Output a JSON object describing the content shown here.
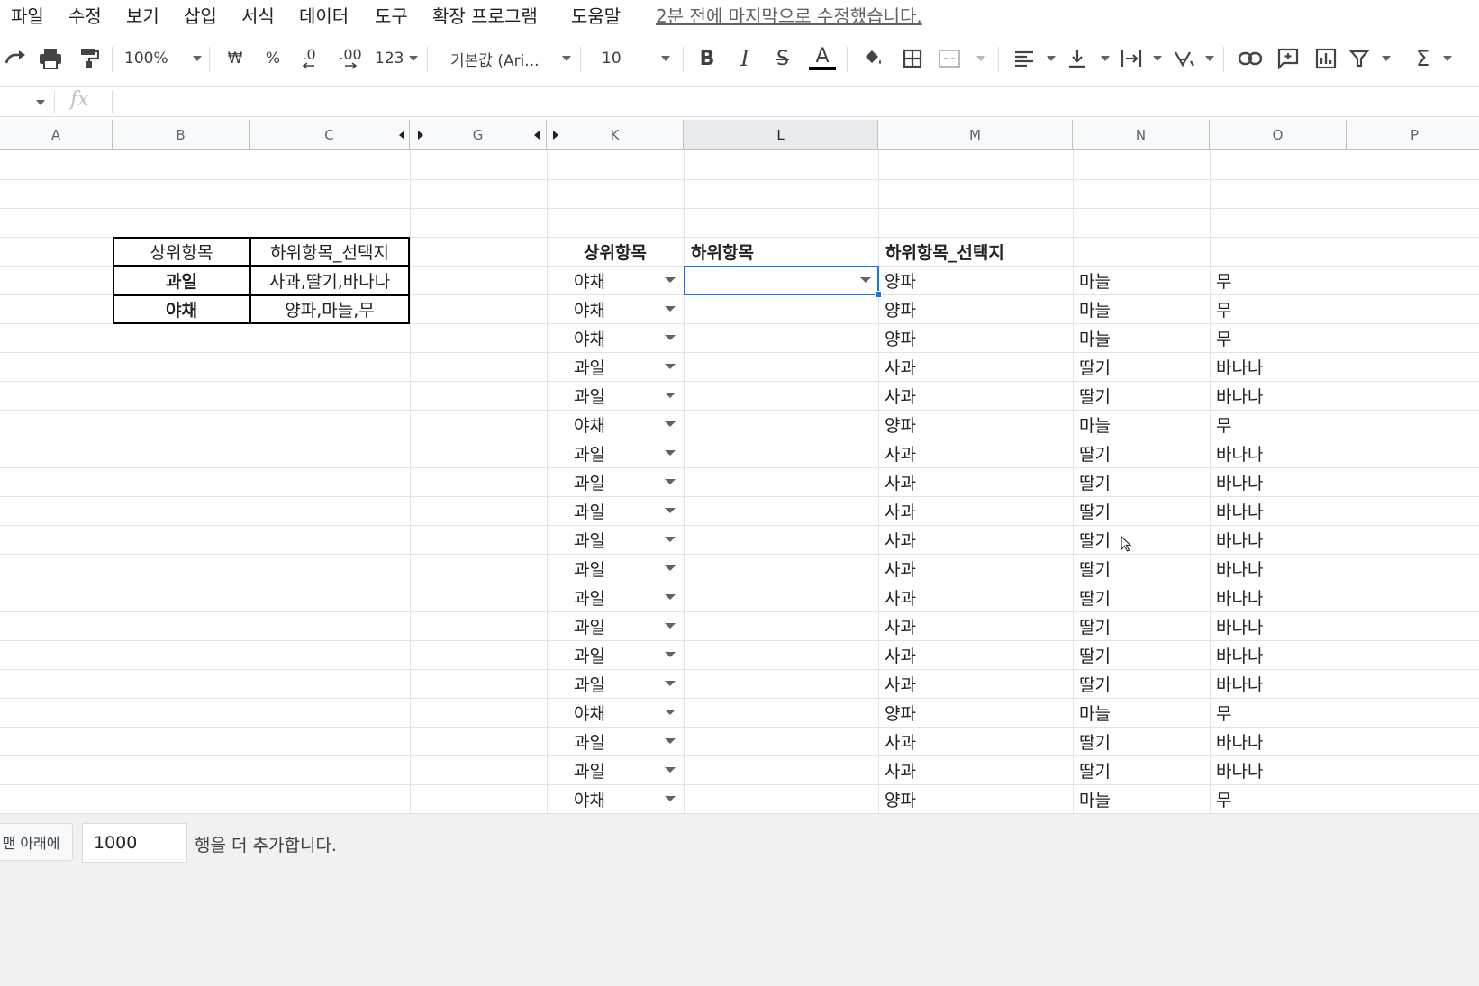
{
  "menu": {
    "items": [
      "파일",
      "수정",
      "보기",
      "삽입",
      "서식",
      "데이터",
      "도구",
      "확장 프로그램",
      "도움말"
    ],
    "last_edit": "2분 전에 마지막으로 수정했습니다."
  },
  "toolbar": {
    "zoom": "100%",
    "currency": "₩",
    "percent": "%",
    "decimal_decrease": ".0",
    "decimal_increase": ".00",
    "number_format": "123",
    "font": "기본값 (Ari...",
    "font_size": "10",
    "bold": "B",
    "italic": "I",
    "strikethrough": "S",
    "text_color": "A",
    "sum": "Σ"
  },
  "formula_bar": {
    "fx": "fx",
    "value": ""
  },
  "columns": [
    "A",
    "B",
    "C",
    "G",
    "K",
    "L",
    "M",
    "N",
    "O",
    "P"
  ],
  "selected_column": "L",
  "lookup_table": {
    "header": [
      "상위항목",
      "하위항목_선택지"
    ],
    "rows": [
      {
        "category": "과일",
        "options": "사과,딸기,바나나"
      },
      {
        "category": "야채",
        "options": "양파,마늘,무"
      }
    ]
  },
  "data_headers": {
    "k": "상위항목",
    "l": "하위항목",
    "m": "하위항목_선택지"
  },
  "data_rows": [
    {
      "k": "야채",
      "l": "",
      "m": "양파",
      "n": "마늘",
      "o": "무"
    },
    {
      "k": "야채",
      "l": "",
      "m": "양파",
      "n": "마늘",
      "o": "무"
    },
    {
      "k": "야채",
      "l": "",
      "m": "양파",
      "n": "마늘",
      "o": "무"
    },
    {
      "k": "과일",
      "l": "",
      "m": "사과",
      "n": "딸기",
      "o": "바나나"
    },
    {
      "k": "과일",
      "l": "",
      "m": "사과",
      "n": "딸기",
      "o": "바나나"
    },
    {
      "k": "야채",
      "l": "",
      "m": "양파",
      "n": "마늘",
      "o": "무"
    },
    {
      "k": "과일",
      "l": "",
      "m": "사과",
      "n": "딸기",
      "o": "바나나"
    },
    {
      "k": "과일",
      "l": "",
      "m": "사과",
      "n": "딸기",
      "o": "바나나"
    },
    {
      "k": "과일",
      "l": "",
      "m": "사과",
      "n": "딸기",
      "o": "바나나"
    },
    {
      "k": "과일",
      "l": "",
      "m": "사과",
      "n": "딸기",
      "o": "바나나"
    },
    {
      "k": "과일",
      "l": "",
      "m": "사과",
      "n": "딸기",
      "o": "바나나"
    },
    {
      "k": "과일",
      "l": "",
      "m": "사과",
      "n": "딸기",
      "o": "바나나"
    },
    {
      "k": "과일",
      "l": "",
      "m": "사과",
      "n": "딸기",
      "o": "바나나"
    },
    {
      "k": "과일",
      "l": "",
      "m": "사과",
      "n": "딸기",
      "o": "바나나"
    },
    {
      "k": "과일",
      "l": "",
      "m": "사과",
      "n": "딸기",
      "o": "바나나"
    },
    {
      "k": "야채",
      "l": "",
      "m": "양파",
      "n": "마늘",
      "o": "무"
    },
    {
      "k": "과일",
      "l": "",
      "m": "사과",
      "n": "딸기",
      "o": "바나나"
    },
    {
      "k": "과일",
      "l": "",
      "m": "사과",
      "n": "딸기",
      "o": "바나나"
    },
    {
      "k": "야채",
      "l": "",
      "m": "양파",
      "n": "마늘",
      "o": "무"
    }
  ],
  "footer": {
    "add_button": "맨 아래에",
    "rows_value": "1000",
    "rows_label": "행을 더 추가합니다."
  },
  "colors": {
    "selection": "#1a73e8",
    "header_bg": "#f8f9fa",
    "bottom_bg": "#f1f1f1"
  }
}
